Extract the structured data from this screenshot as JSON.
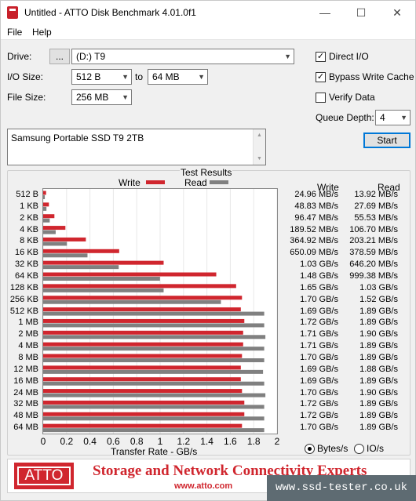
{
  "window": {
    "title": "Untitled - ATTO Disk Benchmark 4.01.0f1",
    "minimize": "—",
    "maximize": "☐",
    "close": "✕"
  },
  "menu": {
    "file": "File",
    "help": "Help"
  },
  "controls": {
    "drive_label": "Drive:",
    "browse_label": "...",
    "drive_value": "(D:) T9",
    "io_size_label": "I/O Size:",
    "io_from": "512 B",
    "io_to_label": "to",
    "io_to": "64 MB",
    "file_size_label": "File Size:",
    "file_size": "256 MB",
    "direct_io_label": "Direct I/O",
    "direct_io_checked": true,
    "bypass_label": "Bypass Write Cache",
    "bypass_checked": true,
    "verify_label": "Verify Data",
    "verify_checked": false,
    "queue_depth_label": "Queue Depth:",
    "queue_depth": "4",
    "start_label": "Start",
    "description": "Samsung Portable SSD T9 2TB"
  },
  "results": {
    "title": "Test Results",
    "write_col": "Write",
    "read_col": "Read",
    "xaxis_label": "Transfer Rate - GB/s",
    "units_bytes": "Bytes/s",
    "units_io": "IO/s",
    "units_selected": "bytes"
  },
  "chart_data": {
    "type": "bar",
    "orientation": "horizontal",
    "categories": [
      "512 B",
      "1 KB",
      "2 KB",
      "4 KB",
      "8 KB",
      "16 KB",
      "32 KB",
      "64 KB",
      "128 KB",
      "256 KB",
      "512 KB",
      "1 MB",
      "2 MB",
      "4 MB",
      "8 MB",
      "12 MB",
      "16 MB",
      "24 MB",
      "32 MB",
      "48 MB",
      "64 MB"
    ],
    "series": [
      {
        "name": "Write",
        "color": "#d0262e",
        "values": [
          0.025,
          0.049,
          0.096,
          0.19,
          0.365,
          0.65,
          1.03,
          1.48,
          1.65,
          1.7,
          1.69,
          1.72,
          1.71,
          1.71,
          1.7,
          1.69,
          1.69,
          1.7,
          1.72,
          1.72,
          1.7
        ],
        "labels": [
          "24.96 MB/s",
          "48.83 MB/s",
          "96.47 MB/s",
          "189.52 MB/s",
          "364.92 MB/s",
          "650.09 MB/s",
          "1.03 GB/s",
          "1.48 GB/s",
          "1.65 GB/s",
          "1.70 GB/s",
          "1.69 GB/s",
          "1.72 GB/s",
          "1.71 GB/s",
          "1.71 GB/s",
          "1.70 GB/s",
          "1.69 GB/s",
          "1.69 GB/s",
          "1.70 GB/s",
          "1.72 GB/s",
          "1.72 GB/s",
          "1.70 GB/s"
        ]
      },
      {
        "name": "Read",
        "color": "#808080",
        "values": [
          0.014,
          0.028,
          0.056,
          0.107,
          0.203,
          0.379,
          0.646,
          0.999,
          1.03,
          1.52,
          1.89,
          1.89,
          1.9,
          1.89,
          1.89,
          1.88,
          1.89,
          1.9,
          1.89,
          1.89,
          1.89
        ],
        "labels": [
          "13.92 MB/s",
          "27.69 MB/s",
          "55.53 MB/s",
          "106.70 MB/s",
          "203.21 MB/s",
          "378.59 MB/s",
          "646.20 MB/s",
          "999.38 MB/s",
          "1.03 GB/s",
          "1.52 GB/s",
          "1.89 GB/s",
          "1.89 GB/s",
          "1.90 GB/s",
          "1.89 GB/s",
          "1.89 GB/s",
          "1.88 GB/s",
          "1.89 GB/s",
          "1.90 GB/s",
          "1.89 GB/s",
          "1.89 GB/s",
          "1.89 GB/s"
        ]
      }
    ],
    "xlim": [
      0,
      2
    ],
    "xticks": [
      "0",
      "0.2",
      "0.4",
      "0.6",
      "0.8",
      "1",
      "1.2",
      "1.4",
      "1.6",
      "1.8",
      "2"
    ],
    "xlabel": "Transfer Rate - GB/s",
    "grid": true
  },
  "banner": {
    "logo_text": "ATTO",
    "tagline": "Storage and Network Connectivity Experts",
    "url": "www.atto.com"
  },
  "watermark": "www.ssd-tester.co.uk"
}
